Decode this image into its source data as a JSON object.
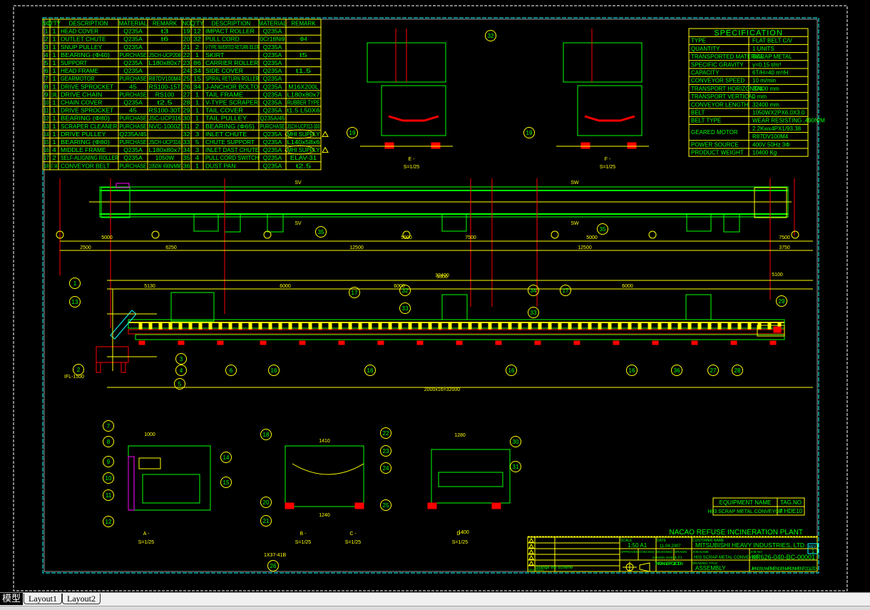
{
  "parts_table": {
    "headers": [
      "NO",
      "Q'TY",
      "DESCRIPTION",
      "MATERIAL",
      "REMARK"
    ],
    "left_rows": [
      [
        "1",
        "1",
        "HEAD COVER",
        "Q235A",
        "t3"
      ],
      [
        "2",
        "1",
        "OUTLET CHUTE",
        "Q235A",
        "t6"
      ],
      [
        "3",
        "1",
        "SNUP PULLEY",
        "Q235A",
        ""
      ],
      [
        "4",
        "1",
        "BEARING (Φ40)",
        "PURCHASE",
        "JSCH-UCP208"
      ],
      [
        "5",
        "1",
        "SUPPORT",
        "Q235A",
        "L180x80x7"
      ],
      [
        "6",
        "1",
        "HEAD FRAME",
        "Q235A",
        ""
      ],
      [
        "7",
        "1",
        "GEARMOTOR",
        "PURCHASE",
        "R87DV100M4"
      ],
      [
        "8",
        "1",
        "DRIVE SPROCKET",
        "45",
        "RS100-15T"
      ],
      [
        "9",
        "106L",
        "DRIVE CHAIN",
        "PURCHASE",
        "RS100"
      ],
      [
        "10",
        "1",
        "CHAIN COVER",
        "Q235A",
        "t2.5"
      ],
      [
        "11",
        "1",
        "DRIVE SPROCKET",
        "45",
        "RS100-30T"
      ],
      [
        "12",
        "1",
        "BEARING (Φ80)",
        "PURCHASE",
        "JSC-UCP316"
      ],
      [
        "13",
        "1",
        "SCRAPER CLEANER",
        "PURCHASE",
        "NVC-1000Z"
      ],
      [
        "14",
        "1",
        "DRIVE PULLEY",
        "Q235A/45",
        ""
      ],
      [
        "15",
        "1",
        "BEARING (Φ80)",
        "PURCHASE",
        "JSCH-UCP316"
      ],
      [
        "16",
        "4",
        "MIDDLE FRAME",
        "Q235A",
        "L180x80x7"
      ],
      [
        "17",
        "2",
        "SELF-ALIGNING ROLLER",
        "Q235A",
        "1050W"
      ],
      [
        "18",
        "67.5M",
        "CONVEYOR BELT",
        "PURCHASE",
        "1050W 490N/MM"
      ]
    ],
    "right_rows": [
      [
        "19",
        "12",
        "IMPACT ROLLER",
        "Q235A",
        ""
      ],
      [
        "20",
        "32",
        "PULL CORD",
        "0Cr18Ni9",
        "Φ4"
      ],
      [
        "21",
        "2",
        "V-TYPE INVERTED RETURN IDLER",
        "Q235A",
        ""
      ],
      [
        "22",
        "1",
        "SKIRT",
        "Q235A",
        "t5"
      ],
      [
        "23",
        "86",
        "CARRIER ROLLER",
        "Q235A",
        ""
      ],
      [
        "24",
        "34",
        "SIDE COVER",
        "Q235A",
        "t1.5"
      ],
      [
        "25",
        "15",
        "SPIRAL RETURN ROLLER",
        "Q235A",
        ""
      ],
      [
        "26",
        "34",
        "J-ANCHOR BOLTO",
        "Q235A",
        "M16X200L"
      ],
      [
        "27",
        "1",
        "TAIL FRAME",
        "Q235A",
        "L180x80x7"
      ],
      [
        "28",
        "1",
        "V-TYPE SCRAPER",
        "Q235A",
        "RUBBER TYPE"
      ],
      [
        "29",
        "1",
        "TAIL COVER",
        "Q235A",
        "t1.5  L50X6"
      ],
      [
        "30",
        "1",
        "TAIL PULLEY",
        "Q235A/45",
        ""
      ],
      [
        "31",
        "2",
        "BEARING (Φ65)",
        "PURCHASE",
        "JSCH-UCP313-300"
      ],
      [
        "32",
        "3",
        "INLET CHUTE",
        "Q235A",
        "MHI SUPPLY"
      ],
      [
        "33",
        "5",
        "CHUTE SUPPORT",
        "Q235A",
        "L140x58x6"
      ],
      [
        "34",
        "3",
        "INLET DAST CHUTE",
        "Q235A",
        "MHI SUPPLY"
      ],
      [
        "35",
        "4",
        "PULL CORD SWITCH",
        "Q235A",
        "ELAV-31"
      ],
      [
        "36",
        "1",
        "DUST PAN",
        "Q235A",
        "t2.5"
      ]
    ]
  },
  "specification": {
    "title": "SPECIFICATION",
    "rows": [
      [
        "TYPE",
        "FLAT BELT C/V"
      ],
      [
        "QUANTITY",
        "1     UNITS"
      ],
      [
        "TRANSPORTED MATERIAL",
        "SCRAP METAL"
      ],
      [
        "SPECIFIC GRAVITY",
        "γ=0.15   t/m³"
      ],
      [
        "CAPACITY",
        "6T/H=40 m³/H"
      ],
      [
        "CONVEYOR SPEED",
        "10  m/min"
      ],
      [
        "TRANSPORT HORIZONTAL",
        "32400 mm"
      ],
      [
        "TRANSPORT VERTICAL",
        "0   mm"
      ],
      [
        "CONVEYOR LENGTH",
        "32400 mm"
      ],
      [
        "BELT",
        "1050WX2PX6.0X3.0"
      ],
      [
        "BELT TYPE",
        "WEAR RESISTING ,490N/M"
      ],
      [
        "GEARED MOTOR",
        "2.2Kwx4PX1/93.38"
      ],
      [
        "",
        "R87DV100M4"
      ],
      [
        "POWER SOURCE",
        "400V 50Hz 3Φ"
      ],
      [
        "PRODUCT WEIGHT",
        "10400 Kg"
      ]
    ]
  },
  "equipment": {
    "name_header": "EQUIPMENT NAME",
    "tag_header": "TAG.NO",
    "name": "H03 SCRAP METAL CONVEYOR",
    "tag": "7 HDE10"
  },
  "title_block": {
    "plant": "NACAO REFUSE INCINERATION PLANT",
    "scale_label": "SCALE",
    "scale": "1:50  A1",
    "date_label": "DATE",
    "date": "11.04.2007",
    "customer_label": "CUSTOMER NAME",
    "customer": "MITSUBISHI HEAVY INDUSTRIES, LTD.",
    "rev_label": "REV",
    "rev": "1",
    "approved": "APPROVED",
    "checked": "CHECKED",
    "designed": "DESIGNED",
    "drawn": "DRAWN",
    "designer": "KUNDRI ISHIDA",
    "drawer": "L.F.I",
    "job_name_label": "JOB NAME",
    "job_name": "H03 SCRAP METAL CONVEYOR",
    "job_no_label": "JOB NO",
    "job_no": "KR626-040-BC-00001",
    "projection": "THIRD ANGLE PROJECTION",
    "drawing_title_label": "DRAWING TITLE",
    "drawing_title": "ASSEMBLY",
    "company": "JIANGSU WEIMENG ENVIRONMENT CO.,LTD",
    "rev_note": "change the scheme",
    "rev_mark": "REVISIONS"
  },
  "views": {
    "e_label": "E -",
    "e_scale": "S=1/25",
    "f_label": "F -",
    "f_scale": "S=1/25",
    "a_label": "A -",
    "a_scale": "S=1/25",
    "b_label": "B -",
    "b_scale": "S=1/25",
    "c_label": "C -",
    "c_scale": "S=1/25",
    "d_label": "D -",
    "d_scale": "S=1/25",
    "sv": "SV",
    "sw": "SW",
    "total_dim": "2000x16=32000",
    "overall": "32400",
    "ifl": "IFL-1500",
    "idler": "1X37-41B"
  },
  "dims": [
    "5000",
    "5000",
    "7500",
    "5000",
    "7500",
    "2500",
    "6250",
    "12500",
    "12500",
    "3750",
    "5130",
    "6000",
    "6000",
    "6000",
    "5100",
    "3300",
    "1410",
    "1280",
    "1000",
    "1240",
    "1400"
  ],
  "callouts": [
    "1",
    "13",
    "2",
    "3",
    "4",
    "5",
    "6",
    "16",
    "16",
    "16",
    "16",
    "17",
    "17",
    "32",
    "33",
    "34",
    "33",
    "36",
    "27",
    "28",
    "29",
    "35",
    "35",
    "19",
    "19",
    "32",
    "7",
    "8",
    "9",
    "10",
    "11",
    "12",
    "14",
    "15",
    "18",
    "22",
    "23",
    "24",
    "25",
    "20",
    "21",
    "26",
    "30",
    "31"
  ],
  "tabs": {
    "model": "模型",
    "layout1": "Layout1",
    "layout2": "Layout2"
  },
  "colors": {
    "background": "#000000",
    "table_lines": "#ffff00",
    "text": "#00ff00",
    "hidden": "#ff0000",
    "frame": "#00ffff"
  }
}
